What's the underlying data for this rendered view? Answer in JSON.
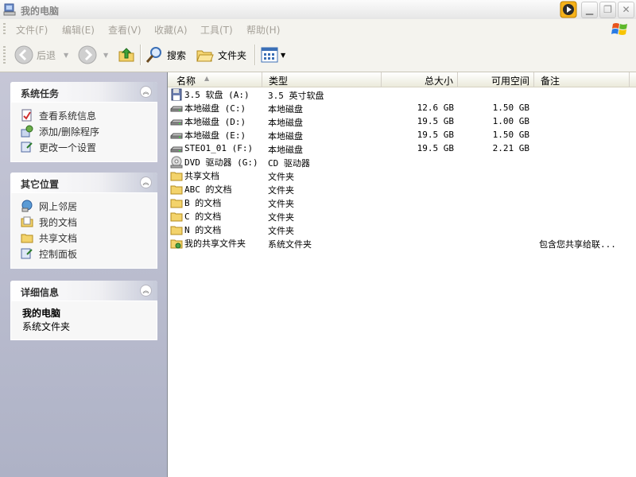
{
  "window": {
    "title": "我的电脑"
  },
  "menu": [
    "文件(F)",
    "编辑(E)",
    "查看(V)",
    "收藏(A)",
    "工具(T)",
    "帮助(H)"
  ],
  "toolbar": {
    "back": "后退",
    "search": "搜索",
    "folders": "文件夹"
  },
  "left_pane": {
    "system_tasks": {
      "title": "系统任务",
      "items": [
        "查看系统信息",
        "添加/删除程序",
        "更改一个设置"
      ]
    },
    "other_places": {
      "title": "其它位置",
      "items": [
        "网上邻居",
        "我的文档",
        "共享文档",
        "控制面板"
      ]
    },
    "details": {
      "title": "详细信息",
      "name": "我的电脑",
      "desc": "系统文件夹"
    }
  },
  "columns": [
    "名称",
    "类型",
    "总大小",
    "可用空间",
    "备注"
  ],
  "rows": [
    {
      "icon": "floppy-icon",
      "name": "3.5 软盘 (A:)",
      "type": "3.5 英寸软盘",
      "total": "",
      "free": "",
      "comment": ""
    },
    {
      "icon": "hard-disk-icon",
      "name": "本地磁盘 (C:)",
      "type": "本地磁盘",
      "total": "12.6 GB",
      "free": "1.50 GB",
      "comment": ""
    },
    {
      "icon": "hard-disk-icon",
      "name": "本地磁盘 (D:)",
      "type": "本地磁盘",
      "total": "19.5 GB",
      "free": "1.00 GB",
      "comment": ""
    },
    {
      "icon": "hard-disk-icon",
      "name": "本地磁盘 (E:)",
      "type": "本地磁盘",
      "total": "19.5 GB",
      "free": "1.50 GB",
      "comment": ""
    },
    {
      "icon": "hard-disk-icon",
      "name": "STEO1_01 (F:)",
      "type": "本地磁盘",
      "total": "19.5 GB",
      "free": "2.21 GB",
      "comment": ""
    },
    {
      "icon": "dvd-drive-icon",
      "name": "DVD 驱动器 (G:)",
      "type": "CD 驱动器",
      "total": "",
      "free": "",
      "comment": ""
    },
    {
      "icon": "folder-icon",
      "name": "共享文档",
      "type": "文件夹",
      "total": "",
      "free": "",
      "comment": ""
    },
    {
      "icon": "folder-icon",
      "name": "ABC 的文档",
      "type": "文件夹",
      "total": "",
      "free": "",
      "comment": ""
    },
    {
      "icon": "folder-icon",
      "name": "B 的文档",
      "type": "文件夹",
      "total": "",
      "free": "",
      "comment": ""
    },
    {
      "icon": "folder-icon",
      "name": "C 的文档",
      "type": "文件夹",
      "total": "",
      "free": "",
      "comment": ""
    },
    {
      "icon": "folder-icon",
      "name": "N 的文档",
      "type": "文件夹",
      "total": "",
      "free": "",
      "comment": ""
    },
    {
      "icon": "shared-folder-icon",
      "name": "我的共享文件夹",
      "type": "系统文件夹",
      "total": "",
      "free": "",
      "comment": "包含您共享给联..."
    }
  ]
}
